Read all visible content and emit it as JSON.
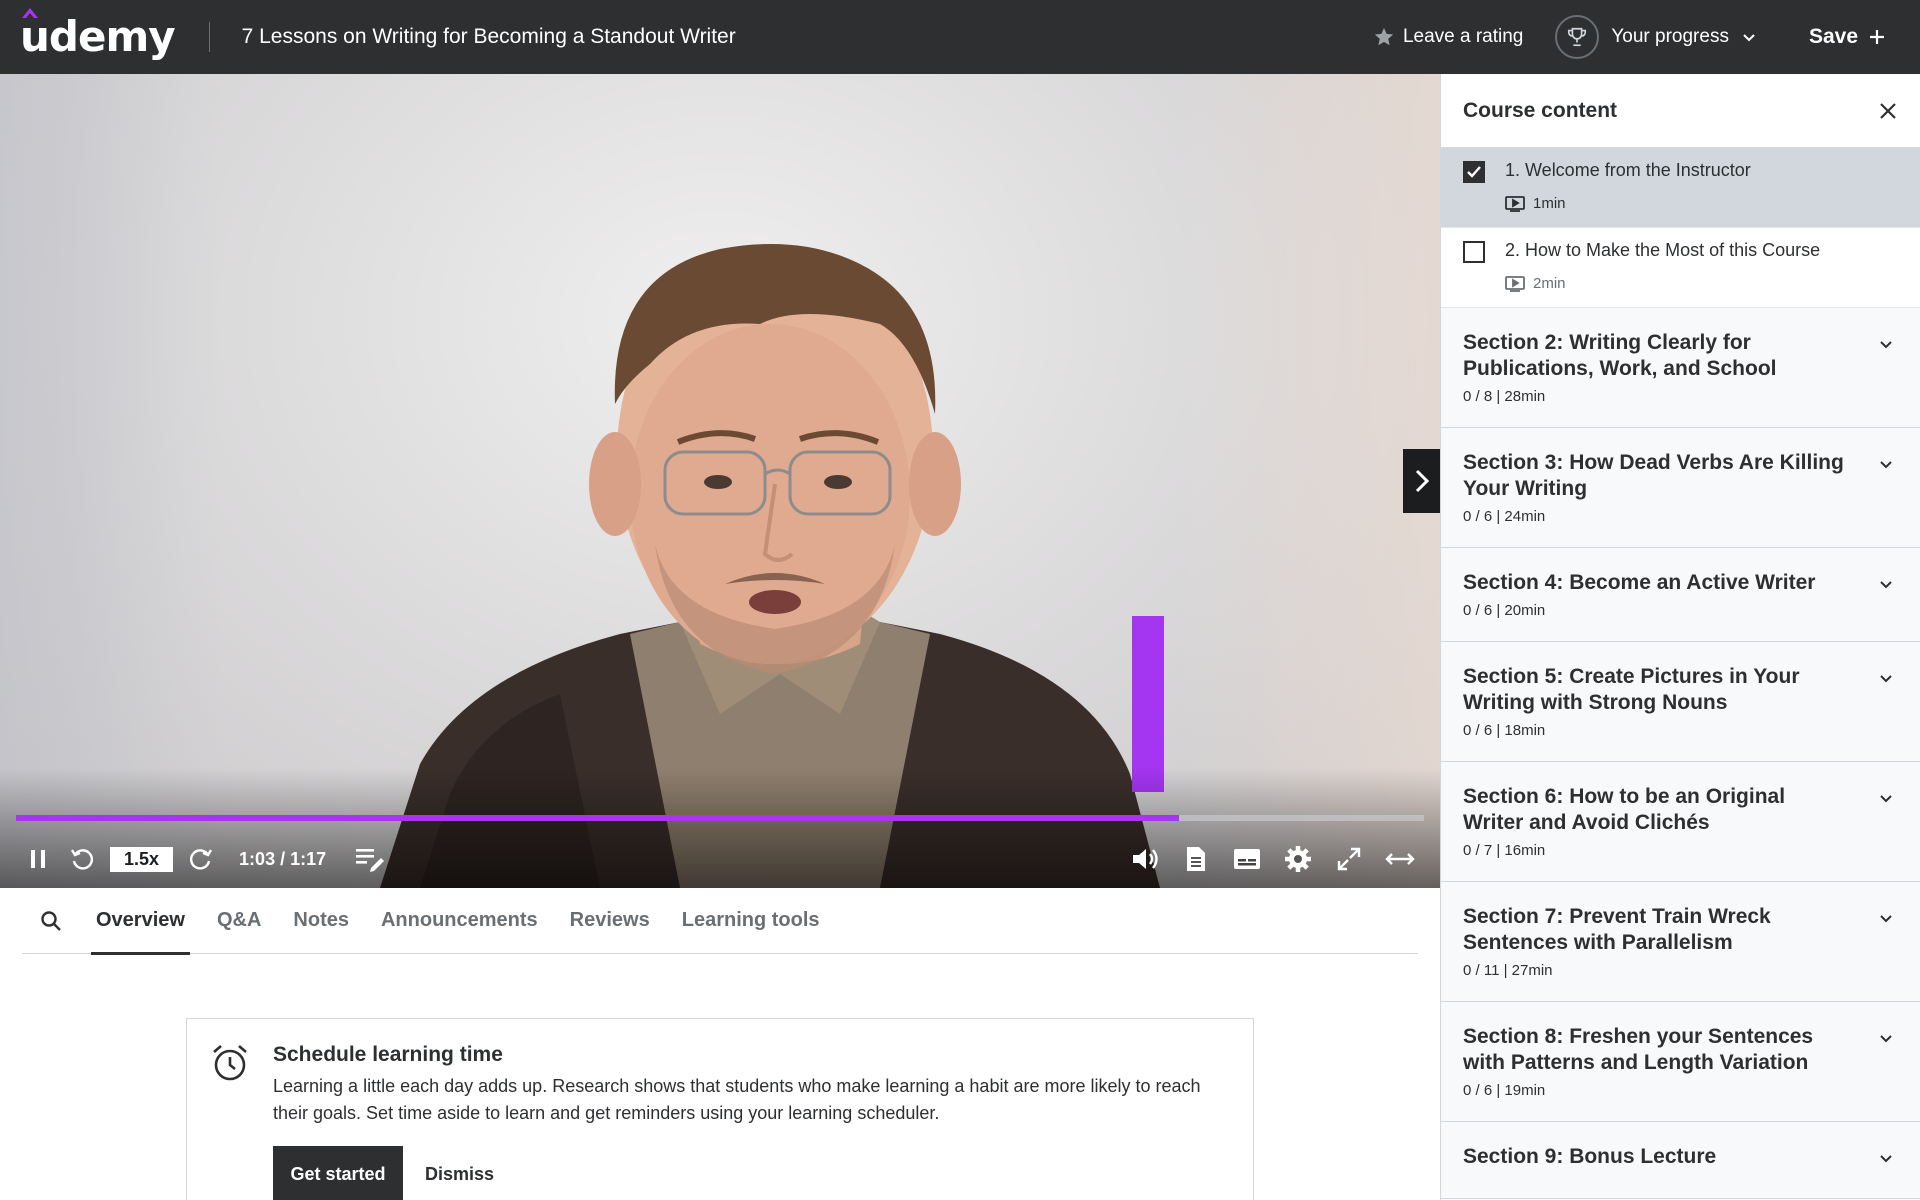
{
  "header": {
    "logo": "udemy",
    "course_title": "7 Lessons on Writing for Becoming a Standout Writer",
    "rating_label": "Leave a rating",
    "progress_label": "Your progress",
    "save_label": "Save"
  },
  "player": {
    "speed": "1.5x",
    "time": "1:03 / 1:17",
    "progress": 0.826,
    "volume_level": 1.0
  },
  "tabs": [
    "Overview",
    "Q&A",
    "Notes",
    "Announcements",
    "Reviews",
    "Learning tools"
  ],
  "active_tab": "Overview",
  "schedule": {
    "title": "Schedule learning time",
    "text": "Learning a little each day adds up. Research shows that students who make learning a habit are more likely to reach their goals. Set time aside to learn and get reminders using your learning scheduler.",
    "primary_label": "Get started",
    "secondary_label": "Dismiss"
  },
  "sidebar": {
    "title": "Course content",
    "lectures": [
      {
        "title": "1. Welcome from the Instructor",
        "duration": "1min",
        "checked": true,
        "current": true
      },
      {
        "title": "2. How to Make the Most of this Course",
        "duration": "2min",
        "checked": false,
        "current": false
      }
    ],
    "sections": [
      {
        "title": "Section 2: Writing Clearly for Publications, Work, and School",
        "meta": "0 / 8 | 28min"
      },
      {
        "title": "Section 3: How Dead Verbs Are Killing Your Writing",
        "meta": "0 / 6 | 24min"
      },
      {
        "title": "Section 4: Become an Active Writer",
        "meta": "0 / 6 | 20min"
      },
      {
        "title": "Section 5: Create Pictures in Your Writing with Strong Nouns",
        "meta": "0 / 6 | 18min"
      },
      {
        "title": "Section 6: How to be an Original Writer and Avoid Clichés",
        "meta": "0 / 7 | 16min"
      },
      {
        "title": "Section 7: Prevent Train Wreck Sentences with Parallelism",
        "meta": "0 / 11 | 27min"
      },
      {
        "title": "Section 8: Freshen your Sentences with Patterns and Length Variation",
        "meta": "0 / 6 | 19min"
      },
      {
        "title": "Section 9: Bonus Lecture",
        "meta": ""
      }
    ]
  },
  "colors": {
    "accent": "#a435f0",
    "header_bg": "#2d2f31",
    "text": "#2d2f31"
  }
}
